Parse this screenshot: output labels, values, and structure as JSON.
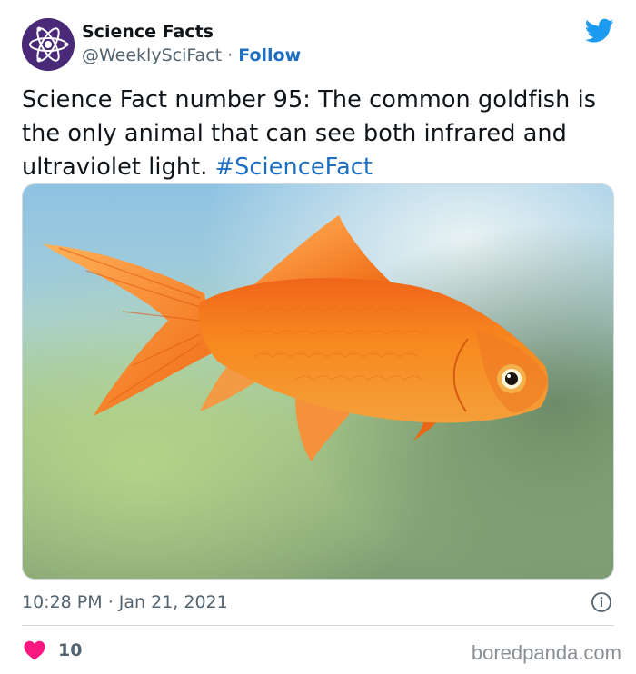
{
  "account": {
    "display_name": "Science Facts",
    "handle": "@WeeklySciFact",
    "separator": "·",
    "follow_label": "Follow"
  },
  "tweet": {
    "text": "Science Fact number 95: The common goldfish is the only animal that can see both infrared and ultraviolet light. ",
    "hashtag": "#ScienceFact",
    "time": "10:28 PM",
    "separator": "·",
    "date": "Jan 21, 2021"
  },
  "engagement": {
    "likes": "10"
  },
  "icons": {
    "platform": "twitter-bird-icon",
    "info": "info-icon",
    "like": "heart-icon",
    "avatar": "atom-icon"
  },
  "colors": {
    "link": "#1d6fc4",
    "platform_blue": "#1d9bf0",
    "heart": "#f91880",
    "avatar_bg": "#4a2a78"
  },
  "watermark": "boredpanda.com"
}
